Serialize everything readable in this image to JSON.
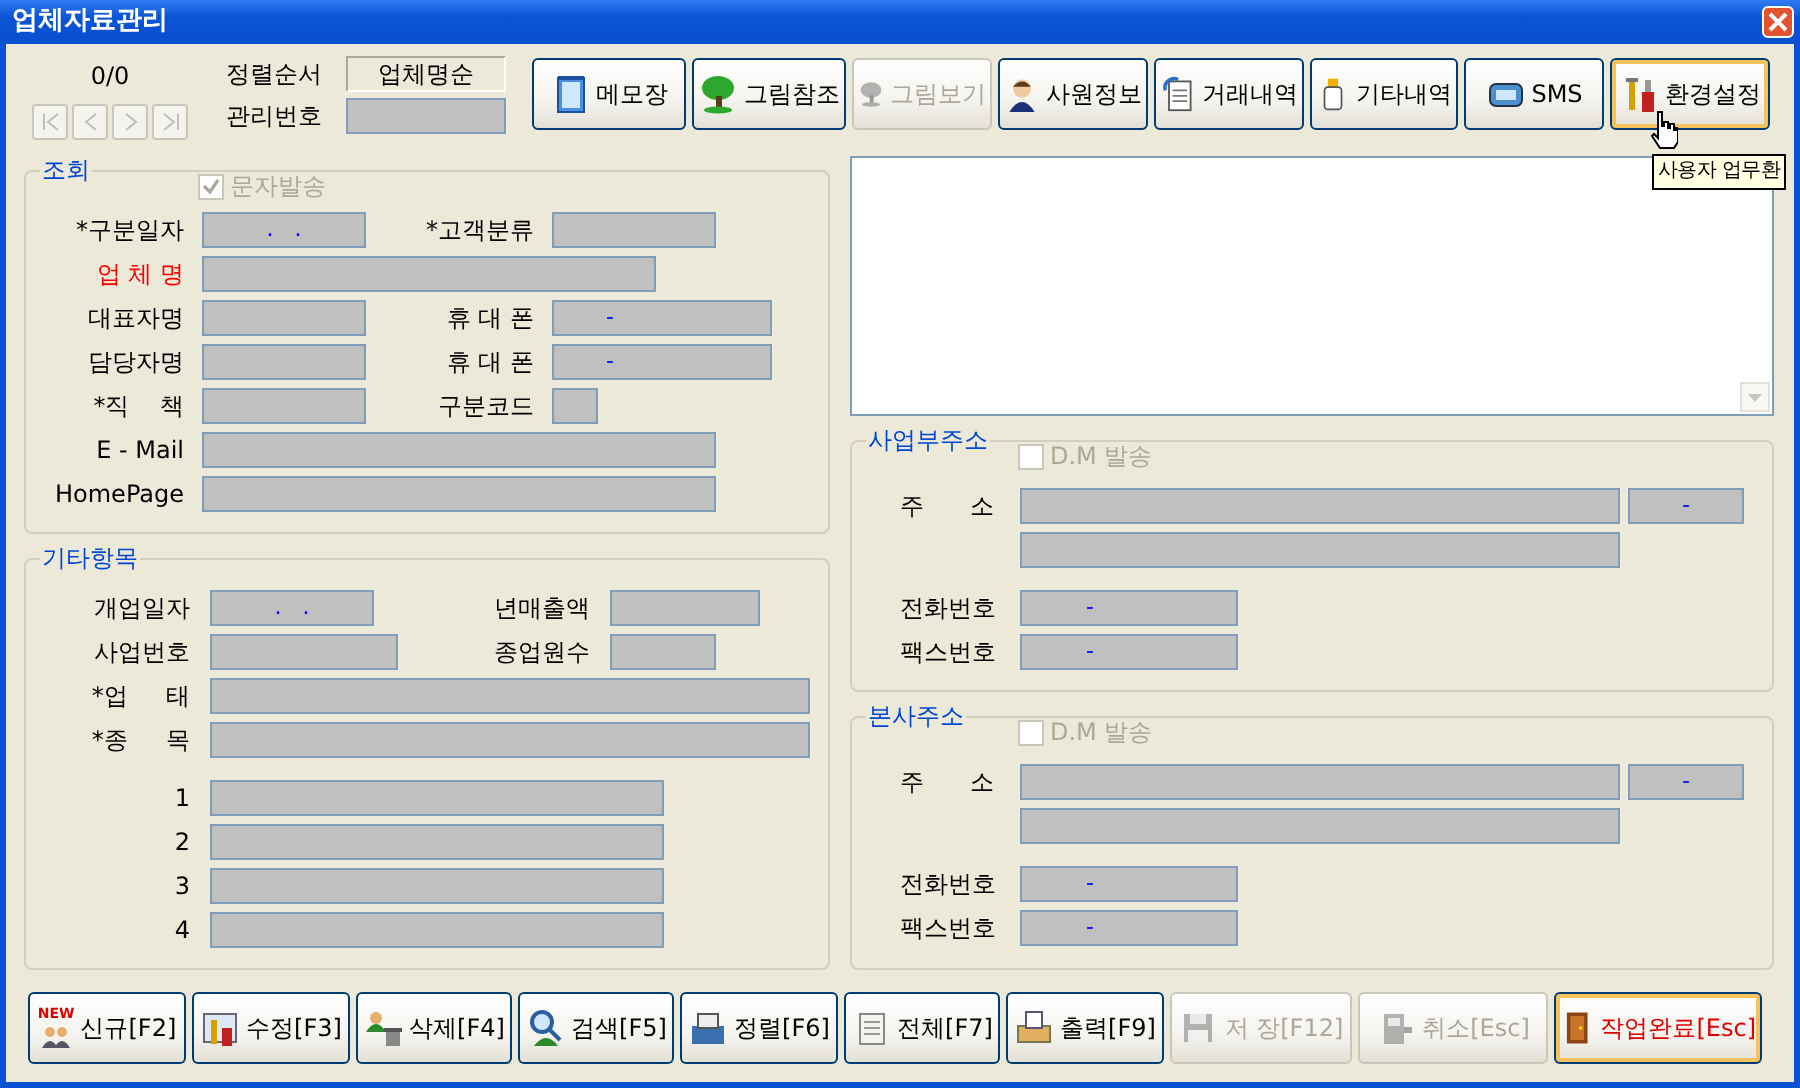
{
  "window": {
    "title": "업체자료관리"
  },
  "navigator": {
    "counter": "0/0",
    "buttons": [
      {
        "disabled": true
      },
      {
        "disabled": true
      },
      {
        "disabled": true
      },
      {
        "disabled": true
      }
    ]
  },
  "sort_order": {
    "label": "정렬순서",
    "value": "업체명순"
  },
  "management_number": {
    "label": "관리번호"
  },
  "toolbar": [
    {
      "label": "메모장",
      "disabled": false,
      "hovered": false
    },
    {
      "label": "그림참조",
      "disabled": false,
      "hovered": false
    },
    {
      "label": "그림보기",
      "disabled": true,
      "hovered": false
    },
    {
      "label": "사원정보",
      "disabled": false,
      "hovered": false
    },
    {
      "label": "거래내역",
      "disabled": false,
      "hovered": false
    },
    {
      "label": "기타내역",
      "disabled": false,
      "hovered": false
    },
    {
      "label": "SMS",
      "disabled": false,
      "hovered": false
    },
    {
      "label": "환경설정",
      "disabled": false,
      "hovered": true
    }
  ],
  "tooltip": "사용자 업무환",
  "inquiry": {
    "title": "조회",
    "sms_checkbox": {
      "label": "문자발송",
      "checked": true,
      "disabled": true
    },
    "rows": [
      [
        {
          "label": "*구분일자",
          "kind": "date",
          "value": ".   .",
          "highlighted": false
        },
        {
          "label": "*고객분류",
          "kind": "short",
          "highlighted": false
        }
      ],
      [
        {
          "label": "업 체 명",
          "kind": "medium",
          "highlighted": true
        }
      ],
      [
        {
          "label": "대표자명",
          "kind": "short",
          "highlighted": false
        },
        {
          "label": "휴 대 폰",
          "kind": "phone",
          "value": "-",
          "highlighted": false
        }
      ],
      [
        {
          "label": "담당자명",
          "kind": "short",
          "highlighted": false
        },
        {
          "label": "휴 대 폰",
          "kind": "phone",
          "value": "-",
          "highlighted": false
        }
      ],
      [
        {
          "label": "*직    책",
          "kind": "short",
          "highlighted": false
        },
        {
          "label": "구분코드",
          "kind": "tiny",
          "highlighted": false
        }
      ],
      [
        {
          "label": "E - Mail",
          "kind": "long",
          "highlighted": false
        }
      ],
      [
        {
          "label": "HomePage",
          "kind": "long",
          "highlighted": false
        }
      ]
    ]
  },
  "other_items": {
    "title": "기타항목",
    "rows": [
      [
        {
          "label": "개업일자",
          "kind": "date",
          "value": ".   ."
        },
        {
          "label": "년매출액",
          "kind": "revenue"
        }
      ],
      [
        {
          "label": "사업번호",
          "kind": "mid"
        },
        {
          "label": "종업원수",
          "kind": "small"
        }
      ],
      [
        {
          "label": "*업     태",
          "kind": "full"
        }
      ],
      [
        {
          "label": "*종     목",
          "kind": "full"
        }
      ],
      [
        {
          "label": "1",
          "kind": "medium"
        }
      ],
      [
        {
          "label": "2",
          "kind": "medium"
        }
      ],
      [
        {
          "label": "3",
          "kind": "medium"
        }
      ],
      [
        {
          "label": "4",
          "kind": "medium"
        }
      ]
    ]
  },
  "business_address": {
    "title": "사업부주소",
    "dm_checkbox": {
      "label": "D.M 발송",
      "checked": false,
      "disabled": true
    },
    "address_label": "주      소",
    "zip_value": "-",
    "phone": {
      "label": "전화번호",
      "value": "-"
    },
    "fax": {
      "label": "팩스번호",
      "value": "-"
    }
  },
  "head_office_address": {
    "title": "본사주소",
    "dm_checkbox": {
      "label": "D.M 발송",
      "checked": false,
      "disabled": true
    },
    "address_label": "주      소",
    "zip_value": "-",
    "phone": {
      "label": "전화번호",
      "value": "-"
    },
    "fax": {
      "label": "팩스번호",
      "value": "-"
    }
  },
  "bottom_buttons": [
    {
      "label": "신규[F2]",
      "badge": "NEW",
      "disabled": false,
      "focused": false
    },
    {
      "label": "수정[F3]",
      "disabled": false,
      "focused": false
    },
    {
      "label": "삭제[F4]",
      "disabled": false,
      "focused": false
    },
    {
      "label": "검색[F5]",
      "disabled": false,
      "focused": false
    },
    {
      "label": "정렬[F6]",
      "disabled": false,
      "focused": false
    },
    {
      "label": "전체[F7]",
      "disabled": false,
      "focused": false
    },
    {
      "label": "출력[F9]",
      "disabled": false,
      "focused": false
    },
    {
      "label": "저 장[F12]",
      "disabled": true,
      "focused": false
    },
    {
      "label": "취소[Esc]",
      "disabled": true,
      "focused": false
    },
    {
      "label": "작업완료[Esc]",
      "disabled": false,
      "focused": true
    }
  ]
}
